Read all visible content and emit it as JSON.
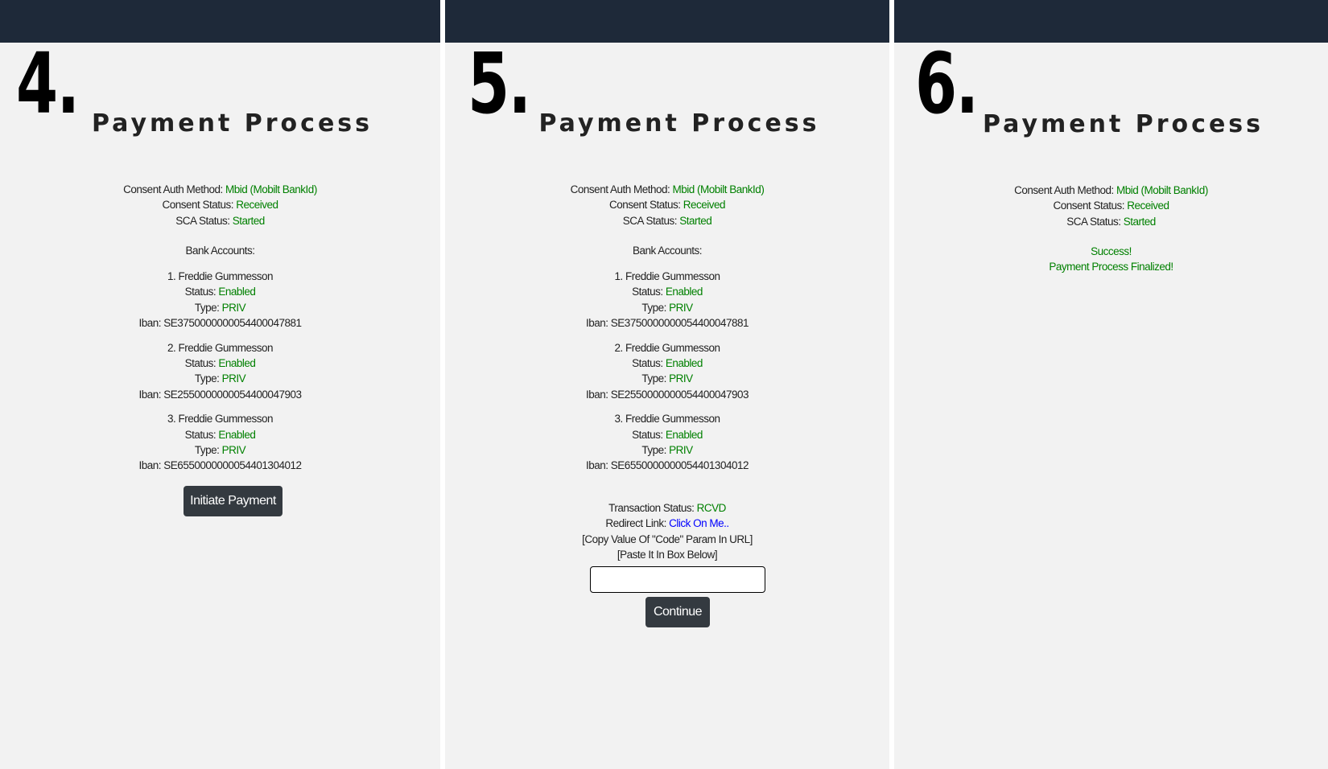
{
  "colors": {
    "header": "#1e2939",
    "background": "#f2f2f2",
    "status_green": "#008000",
    "link_blue": "#0000ff",
    "button": "#343a40"
  },
  "title": "Payment Process",
  "consent": {
    "auth_method_label": "Consent Auth Method: ",
    "auth_method_value": "Mbid (Mobilt BankId)",
    "status_label": "Consent Status: ",
    "status_value": "Received",
    "sca_label": "SCA Status: ",
    "sca_value": "Started"
  },
  "bank_accounts_label": "Bank Accounts:",
  "account_labels": {
    "status": "Status: ",
    "type": "Type: ",
    "iban": "Iban: "
  },
  "accounts": [
    {
      "name": "1. Freddie Gummesson",
      "status": "Enabled",
      "type": "PRIV",
      "iban": "SE3750000000054400047881"
    },
    {
      "name": "2. Freddie Gummesson",
      "status": "Enabled",
      "type": "PRIV",
      "iban": "SE2550000000054400047903"
    },
    {
      "name": "3. Freddie Gummesson",
      "status": "Enabled",
      "type": "PRIV",
      "iban": "SE6550000000054401304012"
    }
  ],
  "panels": [
    {
      "step": "4.",
      "button_label": "Initiate Payment"
    },
    {
      "step": "5.",
      "transaction_label": "Transaction Status: ",
      "transaction_value": "RCVD",
      "redirect_label": "Redirect Link: ",
      "redirect_link": "Click On Me..",
      "instruction_1": "[Copy Value Of \"Code\" Param In URL]",
      "instruction_2": "[Paste It In Box Below]",
      "code_input_value": "",
      "button_label": "Continue"
    },
    {
      "step": "6.",
      "success": "Success!",
      "finalized": "Payment Process Finalized!"
    }
  ]
}
